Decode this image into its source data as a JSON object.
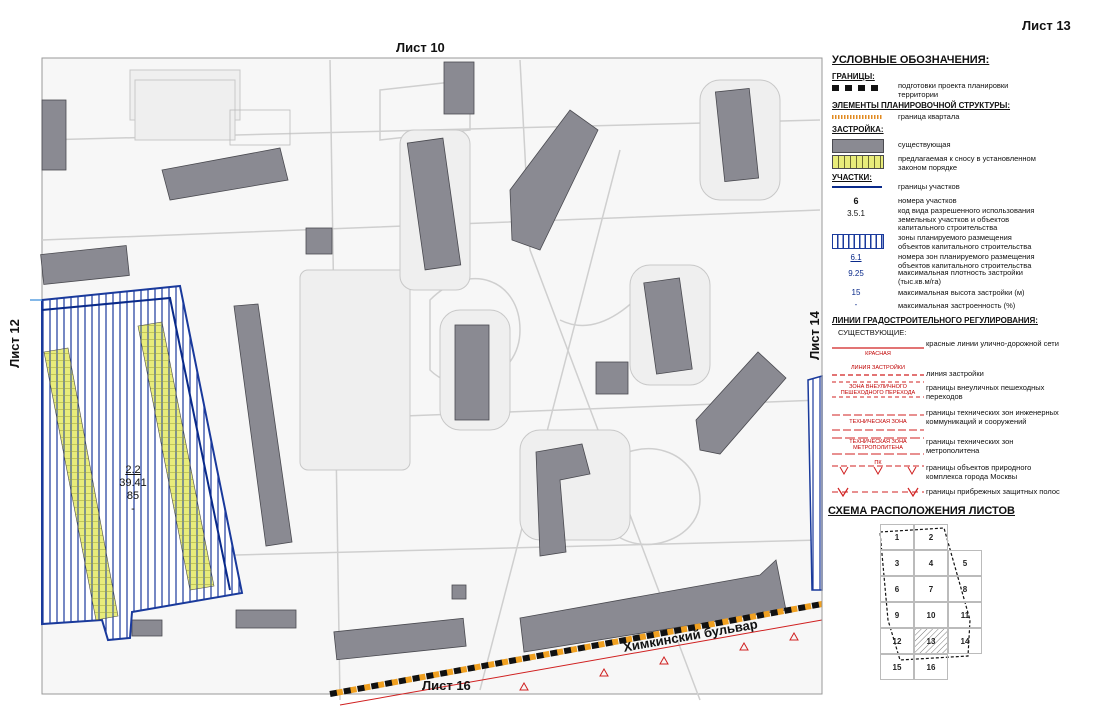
{
  "sheet": {
    "title": "Лист 13",
    "neighbors": {
      "top": "Лист 10",
      "bottom": "Лист 16",
      "left": "Лист 12",
      "right": "Лист 14"
    }
  },
  "map": {
    "street_name": "Химкинский бульвар",
    "zone_label": {
      "zone": "2.2",
      "density": "39.41",
      "height": "85",
      "coverage": "-"
    }
  },
  "legend": {
    "title": "УСЛОВНЫЕ ОБОЗНАЧЕНИЯ:",
    "sections": {
      "borders": "ГРАНИЦЫ:",
      "elements": "ЭЛЕМЕНТЫ ПЛАНИРОВОЧНОЙ СТРУКТУРЫ:",
      "buildings": "ЗАСТРОЙКА:",
      "plots": "УЧАСТКИ:",
      "lines": "ЛИНИИ ГРАДОСТРОИТЕЛЬНОГО РЕГУЛИРОВАНИЯ:",
      "existing": "СУЩЕСТВУЮЩИЕ:"
    },
    "items": {
      "project_border": "подготовки проекта планировки территории",
      "block_border": "граница квартала",
      "existing_building": "существующая",
      "demolition": "предлагаемая к сносу в установленном законом порядке",
      "plot_border": "границы участков",
      "plot_number": "номера участков",
      "plot_number_sample": "6",
      "use_code": "код вида разрешенного использования земельных участков и объектов капитального строительства",
      "use_code_sample": "3.5.1",
      "zones": "зоны планируемого размещения объектов капитального строительства",
      "zone_number": "номера зон планируемого размещения объектов капитального строительства",
      "zone_number_sample": "6.1",
      "density": "максимальная плотность застройки (тыс.кв.м/га)",
      "density_sample": "9.25",
      "height": "максимальная высота застройки (м)",
      "height_sample": "15",
      "coverage": "максимальная застроенность (%)",
      "coverage_sample": "-",
      "red_lines": "красные линии улично-дорожной сети",
      "red_lines_label": "КРАСНАЯ",
      "building_line": "линия застройки",
      "building_line_label": "ЛИНИЯ ЗАСТРОЙКИ",
      "crossings": "границы внеуличных пешеходных переходов",
      "crossings_label": "ЗОНА ВНЕУЛИЧНОГО ПЕШЕХОДНОГО ПЕРЕХОДА",
      "tech_zones": "границы технических зон инженерных коммуникаций и сооружений",
      "tech_zones_label": "ТЕХНИЧЕСКАЯ ЗОНА",
      "metro_zones": "границы технических зон метрополитена",
      "metro_zones_label": "ТЕХНИЧЕСКАЯ ЗОНА МЕТРОПОЛИТЕНА",
      "nature": "границы объектов природного комплекса города Москвы",
      "nature_label": "ПК",
      "coastal": "границы прибрежных защитных полос"
    }
  },
  "scheme": {
    "title": "СХЕМА РАСПОЛОЖЕНИЯ ЛИСТОВ",
    "cells": [
      "1",
      "2",
      "3",
      "4",
      "5",
      "6",
      "7",
      "8",
      "9",
      "10",
      "11",
      "12",
      "13",
      "14",
      "15",
      "16"
    ]
  },
  "colors": {
    "building": "#8a8a92",
    "building_stroke": "#4a4a50",
    "zone_blue": "#1a3a9c",
    "plot_line": "#0a2a8a",
    "demolition": "#e8ec7a",
    "red_line": "#d02020",
    "light_blue": "#5aa0e0"
  }
}
